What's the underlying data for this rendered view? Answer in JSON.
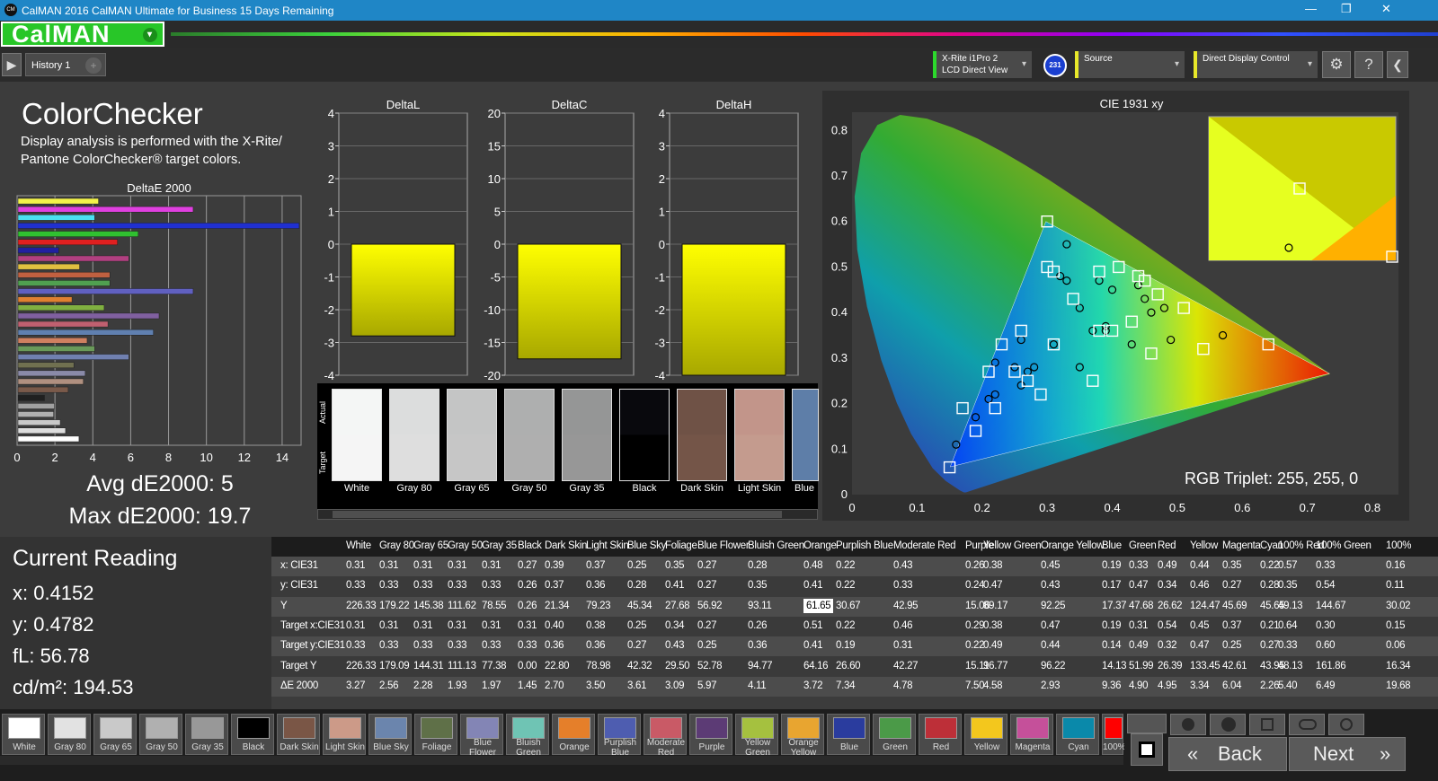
{
  "window": {
    "title": "CalMAN 2016 CalMAN Ultimate for Business 15 Days Remaining",
    "minimize": "—",
    "maximize": "❐",
    "close": "✕"
  },
  "brand": {
    "logo": "CalMAN",
    "dropdown_icon": "▾"
  },
  "toolbar": {
    "history_tab": "History 1",
    "add_tab": "+",
    "meter": {
      "line1": "X-Rite i1Pro 2",
      "line2": "LCD Direct View"
    },
    "meter_badge": "231",
    "source": "Source",
    "display": "Direct Display Control",
    "caret": "▾",
    "settings_icon": "⚙",
    "help_icon": "?",
    "collapse_icon": "❮",
    "play_icon": "▶"
  },
  "colorchecker": {
    "title": "ColorChecker",
    "description": "Display analysis is performed with the X-Rite/ Pantone ColorChecker® target colors.",
    "avg": "Avg dE2000: 5",
    "max": "Max dE2000: 19.7"
  },
  "deltae_chart": {
    "type": "bar",
    "title": "DeltaE 2000",
    "xticks": [
      "0",
      "2",
      "4",
      "6",
      "8",
      "10",
      "12",
      "14"
    ],
    "xlim": [
      0,
      15
    ],
    "bars": [
      {
        "v": 4.3,
        "c": "#f3f34a"
      },
      {
        "v": 9.3,
        "c": "#e040e0"
      },
      {
        "v": 4.1,
        "c": "#4ae0f0"
      },
      {
        "v": 14.9,
        "c": "#2030d0"
      },
      {
        "v": 6.4,
        "c": "#30c030"
      },
      {
        "v": 5.3,
        "c": "#e02020"
      },
      {
        "v": 2.2,
        "c": "#2020a0"
      },
      {
        "v": 5.9,
        "c": "#b04080"
      },
      {
        "v": 3.3,
        "c": "#e0c040"
      },
      {
        "v": 4.9,
        "c": "#c06040"
      },
      {
        "v": 4.9,
        "c": "#50a050"
      },
      {
        "v": 9.3,
        "c": "#6060c0"
      },
      {
        "v": 2.9,
        "c": "#e08030"
      },
      {
        "v": 4.6,
        "c": "#80b040"
      },
      {
        "v": 7.5,
        "c": "#8060a0"
      },
      {
        "v": 4.8,
        "c": "#c06070"
      },
      {
        "v": 7.2,
        "c": "#6080b0"
      },
      {
        "v": 3.7,
        "c": "#d08060"
      },
      {
        "v": 4.1,
        "c": "#6a9a5a"
      },
      {
        "v": 5.9,
        "c": "#7080b0"
      },
      {
        "v": 3.0,
        "c": "#707050"
      },
      {
        "v": 3.6,
        "c": "#8a8aa8"
      },
      {
        "v": 3.5,
        "c": "#b09080"
      },
      {
        "v": 2.7,
        "c": "#7a5a4a"
      },
      {
        "v": 1.45,
        "c": "#202020"
      },
      {
        "v": 1.97,
        "c": "#a0a0a0"
      },
      {
        "v": 1.93,
        "c": "#b0b0b0"
      },
      {
        "v": 2.28,
        "c": "#c8c8c8"
      },
      {
        "v": 2.56,
        "c": "#dddddd"
      },
      {
        "v": 3.27,
        "c": "#ffffff"
      }
    ]
  },
  "delta_charts": [
    {
      "type": "bar",
      "title": "DeltaL",
      "yticks": [
        "4",
        "3",
        "2",
        "1",
        "0",
        "-1",
        "-2",
        "-3",
        "-4"
      ],
      "ylim": [
        -4,
        4
      ],
      "value": -2.8
    },
    {
      "type": "bar",
      "title": "DeltaC",
      "yticks": [
        "20",
        "15",
        "10",
        "5",
        "0",
        "-5",
        "-10",
        "-15",
        "-20"
      ],
      "ylim": [
        -20,
        20
      ],
      "value": -17.5
    },
    {
      "type": "bar",
      "title": "DeltaH",
      "yticks": [
        "4",
        "3",
        "2",
        "1",
        "0",
        "-1",
        "-2",
        "-3",
        "-4"
      ],
      "ylim": [
        -4,
        4
      ],
      "value": -4.0
    }
  ],
  "swatches": {
    "actual_label": "Actual",
    "target_label": "Target",
    "items": [
      {
        "name": "White",
        "a": "#f4f6f5",
        "t": "#f5f5f5"
      },
      {
        "name": "Gray 80",
        "a": "#dcdddd",
        "t": "#dedede"
      },
      {
        "name": "Gray 65",
        "a": "#c4c5c5",
        "t": "#c6c6c6"
      },
      {
        "name": "Gray 50",
        "a": "#aeafaf",
        "t": "#afafaf"
      },
      {
        "name": "Gray 35",
        "a": "#959696",
        "t": "#979797"
      },
      {
        "name": "Black",
        "a": "#09090d",
        "t": "#000000"
      },
      {
        "name": "Dark Skin",
        "a": "#6f5246",
        "t": "#745548"
      },
      {
        "name": "Light Skin",
        "a": "#c2958a",
        "t": "#c49b8e"
      },
      {
        "name": "Blue",
        "a": "#5e7ea8",
        "t": "#5e7ea8"
      }
    ]
  },
  "chart_data": {
    "type": "scatter",
    "title": "CIE 1931 xy",
    "xticks": [
      "0",
      "0.1",
      "0.2",
      "0.3",
      "0.4",
      "0.5",
      "0.6",
      "0.7",
      "0.8"
    ],
    "yticks": [
      "0",
      "0.1",
      "0.2",
      "0.3",
      "0.4",
      "0.5",
      "0.6",
      "0.7",
      "0.8"
    ],
    "xlim": [
      0,
      0.84
    ],
    "ylim": [
      0,
      0.84
    ],
    "gamut": [
      [
        0.298,
        0.6
      ],
      [
        0.734,
        0.266
      ],
      [
        0.151,
        0.061
      ]
    ],
    "targets": [
      [
        0.31,
        0.33
      ],
      [
        0.4,
        0.36
      ],
      [
        0.38,
        0.36
      ],
      [
        0.25,
        0.27
      ],
      [
        0.34,
        0.43
      ],
      [
        0.27,
        0.25
      ],
      [
        0.26,
        0.36
      ],
      [
        0.51,
        0.41
      ],
      [
        0.22,
        0.19
      ],
      [
        0.46,
        0.31
      ],
      [
        0.29,
        0.22
      ],
      [
        0.38,
        0.49
      ],
      [
        0.47,
        0.44
      ],
      [
        0.19,
        0.14
      ],
      [
        0.31,
        0.49
      ],
      [
        0.54,
        0.32
      ],
      [
        0.45,
        0.47
      ],
      [
        0.37,
        0.25
      ],
      [
        0.21,
        0.27
      ],
      [
        0.64,
        0.33
      ],
      [
        0.3,
        0.6
      ],
      [
        0.15,
        0.06
      ],
      [
        0.3,
        0.5
      ],
      [
        0.41,
        0.5
      ],
      [
        0.44,
        0.48
      ],
      [
        0.43,
        0.38
      ],
      [
        0.17,
        0.19
      ],
      [
        0.23,
        0.33
      ]
    ],
    "actuals": [
      [
        0.31,
        0.33
      ],
      [
        0.39,
        0.36
      ],
      [
        0.37,
        0.36
      ],
      [
        0.25,
        0.28
      ],
      [
        0.35,
        0.41
      ],
      [
        0.27,
        0.27
      ],
      [
        0.26,
        0.34
      ],
      [
        0.48,
        0.41
      ],
      [
        0.22,
        0.22
      ],
      [
        0.43,
        0.33
      ],
      [
        0.26,
        0.24
      ],
      [
        0.38,
        0.47
      ],
      [
        0.45,
        0.43
      ],
      [
        0.19,
        0.17
      ],
      [
        0.33,
        0.47
      ],
      [
        0.49,
        0.34
      ],
      [
        0.44,
        0.46
      ],
      [
        0.35,
        0.28
      ],
      [
        0.22,
        0.29
      ],
      [
        0.57,
        0.35
      ],
      [
        0.33,
        0.55
      ],
      [
        0.16,
        0.11
      ],
      [
        0.32,
        0.48
      ],
      [
        0.4,
        0.45
      ],
      [
        0.46,
        0.4
      ],
      [
        0.39,
        0.37
      ],
      [
        0.21,
        0.21
      ],
      [
        0.28,
        0.28
      ]
    ],
    "rgb_triplet": "RGB Triplet: 255, 255, 0"
  },
  "reading": {
    "title": "Current Reading",
    "x": "x: 0.4152",
    "y": "y: 0.4782",
    "fl": "fL: 56.78",
    "cdm": "cd/m²: 194.53"
  },
  "table": {
    "columns": [
      "White",
      "Gray 80",
      "Gray 65",
      "Gray 50",
      "Gray 35",
      "Black",
      "Dark Skin",
      "Light Skin",
      "Blue Sky",
      "Foliage",
      "Blue Flower",
      "Bluish Green",
      "Orange",
      "Purplish Blue",
      "Moderate Red",
      "Purple",
      "Yellow Green",
      "Orange Yellow",
      "Blue",
      "Green",
      "Red",
      "Yellow",
      "Magenta",
      "Cyan",
      "100% Red",
      "100% Green",
      "100%"
    ],
    "rows": [
      {
        "label": "x: CIE31",
        "cells": [
          "0.31",
          "0.31",
          "0.31",
          "0.31",
          "0.31",
          "0.27",
          "0.39",
          "0.37",
          "0.25",
          "0.35",
          "0.27",
          "0.28",
          "0.48",
          "0.22",
          "0.43",
          "0.26",
          "0.38",
          "0.45",
          "0.19",
          "0.33",
          "0.49",
          "0.44",
          "0.35",
          "0.22",
          "0.57",
          "0.33",
          "0.16"
        ]
      },
      {
        "label": "y: CIE31",
        "cells": [
          "0.33",
          "0.33",
          "0.33",
          "0.33",
          "0.33",
          "0.26",
          "0.37",
          "0.36",
          "0.28",
          "0.41",
          "0.27",
          "0.35",
          "0.41",
          "0.22",
          "0.33",
          "0.24",
          "0.47",
          "0.43",
          "0.17",
          "0.47",
          "0.34",
          "0.46",
          "0.27",
          "0.28",
          "0.35",
          "0.54",
          "0.11"
        ]
      },
      {
        "label": "Y",
        "cells": [
          "226.33",
          "179.22",
          "145.38",
          "111.62",
          "78.55",
          "0.26",
          "21.34",
          "79.23",
          "45.34",
          "27.68",
          "56.92",
          "93.11",
          "61.65",
          "30.67",
          "42.95",
          "15.06",
          "89.17",
          "92.25",
          "17.37",
          "47.68",
          "26.62",
          "124.47",
          "45.69",
          "45.65",
          "49.13",
          "144.67",
          "30.02"
        ]
      },
      {
        "label": "Target x:CIE31",
        "cells": [
          "0.31",
          "0.31",
          "0.31",
          "0.31",
          "0.31",
          "0.31",
          "0.40",
          "0.38",
          "0.25",
          "0.34",
          "0.27",
          "0.26",
          "0.51",
          "0.22",
          "0.46",
          "0.29",
          "0.38",
          "0.47",
          "0.19",
          "0.31",
          "0.54",
          "0.45",
          "0.37",
          "0.21",
          "0.64",
          "0.30",
          "0.15"
        ]
      },
      {
        "label": "Target y:CIE31",
        "cells": [
          "0.33",
          "0.33",
          "0.33",
          "0.33",
          "0.33",
          "0.33",
          "0.36",
          "0.36",
          "0.27",
          "0.43",
          "0.25",
          "0.36",
          "0.41",
          "0.19",
          "0.31",
          "0.22",
          "0.49",
          "0.44",
          "0.14",
          "0.49",
          "0.32",
          "0.47",
          "0.25",
          "0.27",
          "0.33",
          "0.60",
          "0.06"
        ]
      },
      {
        "label": "Target Y",
        "cells": [
          "226.33",
          "179.09",
          "144.31",
          "111.13",
          "77.38",
          "0.00",
          "22.80",
          "78.98",
          "42.32",
          "29.50",
          "52.78",
          "94.77",
          "64.16",
          "26.60",
          "42.27",
          "15.11",
          "96.77",
          "96.22",
          "14.13",
          "51.99",
          "26.39",
          "133.45",
          "42.61",
          "43.95",
          "48.13",
          "161.86",
          "16.34"
        ]
      },
      {
        "label": "ΔE 2000",
        "cells": [
          "3.27",
          "2.56",
          "2.28",
          "1.93",
          "1.97",
          "1.45",
          "2.70",
          "3.50",
          "3.61",
          "3.09",
          "5.97",
          "4.11",
          "3.72",
          "7.34",
          "4.78",
          "7.50",
          "4.58",
          "2.93",
          "9.36",
          "4.90",
          "4.95",
          "3.34",
          "6.04",
          "2.26",
          "5.40",
          "6.49",
          "19.68"
        ]
      }
    ]
  },
  "patches": [
    {
      "name": "White",
      "c": "#ffffff"
    },
    {
      "name": "Gray 80",
      "c": "#e2e2e2"
    },
    {
      "name": "Gray 65",
      "c": "#c9c9c9"
    },
    {
      "name": "Gray 50",
      "c": "#b0b0b0"
    },
    {
      "name": "Gray 35",
      "c": "#989898"
    },
    {
      "name": "Black",
      "c": "#000000"
    },
    {
      "name": "Dark Skin",
      "c": "#7a5646"
    },
    {
      "name": "Light Skin",
      "c": "#cc9a88"
    },
    {
      "name": "Blue Sky",
      "c": "#6b85ad"
    },
    {
      "name": "Foliage",
      "c": "#5f7048"
    },
    {
      "name": "Blue Flower",
      "c": "#8385b5"
    },
    {
      "name": "Bluish Green",
      "c": "#6fc4b4"
    },
    {
      "name": "Orange",
      "c": "#e57f2a"
    },
    {
      "name": "Purplish Blue",
      "c": "#4e5db0"
    },
    {
      "name": "Moderate Red",
      "c": "#c95a66"
    },
    {
      "name": "Purple",
      "c": "#5c3b75"
    },
    {
      "name": "Yellow Green",
      "c": "#a5c13f"
    },
    {
      "name": "Orange Yellow",
      "c": "#e8a530"
    },
    {
      "name": "Blue",
      "c": "#2a3c9e"
    },
    {
      "name": "Green",
      "c": "#4b9a48"
    },
    {
      "name": "Red",
      "c": "#bd2f38"
    },
    {
      "name": "Yellow",
      "c": "#f3c71d"
    },
    {
      "name": "Magenta",
      "c": "#c5509a"
    },
    {
      "name": "Cyan",
      "c": "#0a89aa"
    },
    {
      "name": "100%",
      "c": "#ff0000"
    }
  ],
  "nav": {
    "back": "Back",
    "next": "Next",
    "back_icon": "«",
    "next_icon": "»"
  }
}
